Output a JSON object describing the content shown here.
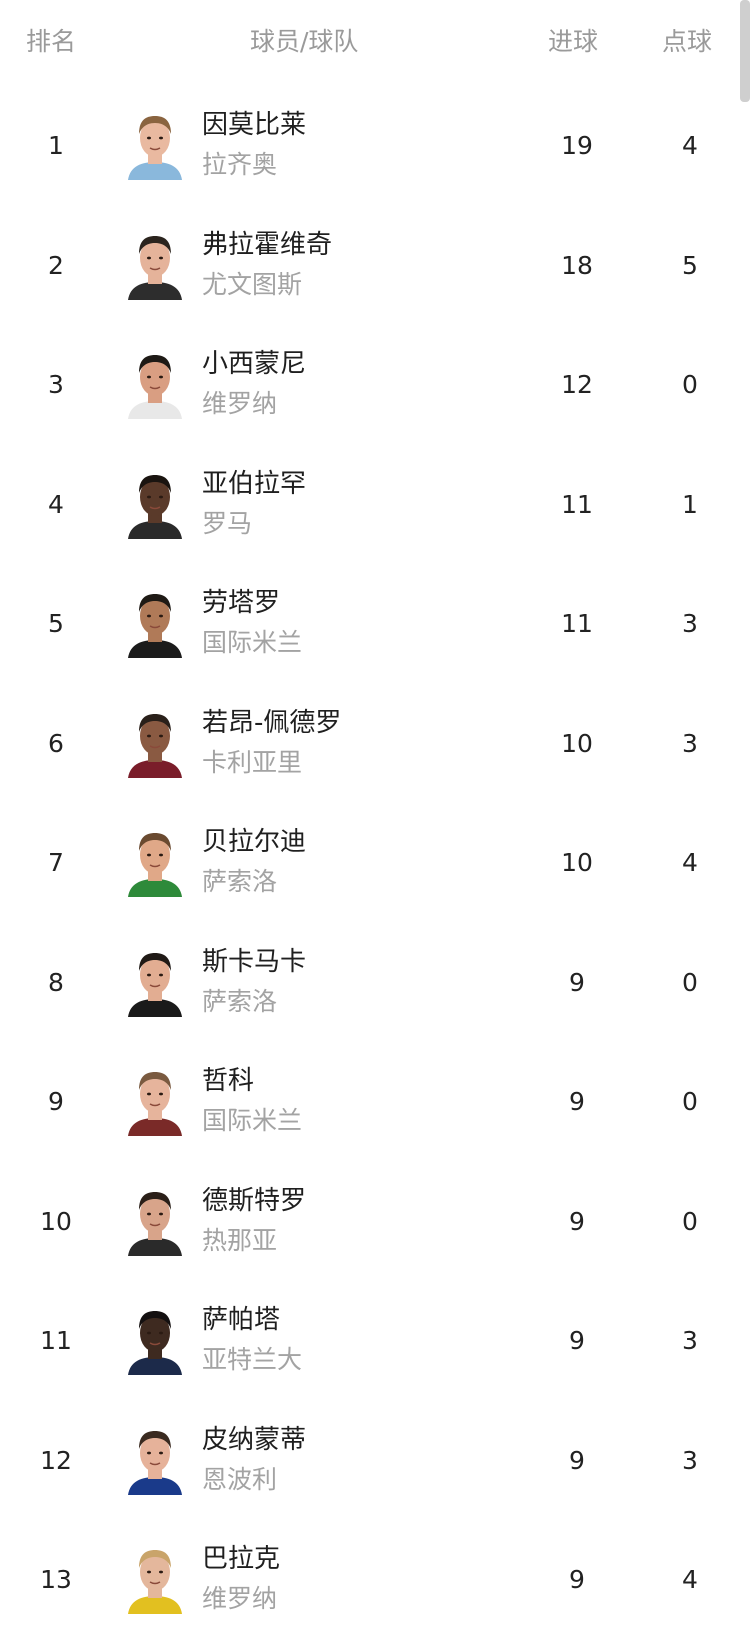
{
  "headers": {
    "rank": "排名",
    "player": "球员/球队",
    "goals": "进球",
    "penalties": "点球"
  },
  "rows": [
    {
      "rank": "1",
      "name": "因莫比莱",
      "team": "拉齐奥",
      "goals": "19",
      "penalties": "4",
      "skin": "#e9b9a0",
      "hair": "#8a6440",
      "shirt": "#8ab8dc"
    },
    {
      "rank": "2",
      "name": "弗拉霍维奇",
      "team": "尤文图斯",
      "goals": "18",
      "penalties": "5",
      "skin": "#e5b39a",
      "hair": "#2b241e",
      "shirt": "#2d2d2d"
    },
    {
      "rank": "3",
      "name": "小西蒙尼",
      "team": "维罗纳",
      "goals": "12",
      "penalties": "0",
      "skin": "#d99e82",
      "hair": "#1e1a16",
      "shirt": "#e8e8e8"
    },
    {
      "rank": "4",
      "name": "亚伯拉罕",
      "team": "罗马",
      "goals": "11",
      "penalties": "1",
      "skin": "#5a3a2a",
      "hair": "#1a1410",
      "shirt": "#2a2a2a"
    },
    {
      "rank": "5",
      "name": "劳塔罗",
      "team": "国际米兰",
      "goals": "11",
      "penalties": "3",
      "skin": "#b07a58",
      "hair": "#1f1a15",
      "shirt": "#1b1b1b"
    },
    {
      "rank": "6",
      "name": "若昂-佩德罗",
      "team": "卡利亚里",
      "goals": "10",
      "penalties": "3",
      "skin": "#8a5a42",
      "hair": "#2a201a",
      "shirt": "#7a1d2a"
    },
    {
      "rank": "7",
      "name": "贝拉尔迪",
      "team": "萨索洛",
      "goals": "10",
      "penalties": "4",
      "skin": "#e0a888",
      "hair": "#6a4a30",
      "shirt": "#2e8a3a"
    },
    {
      "rank": "8",
      "name": "斯卡马卡",
      "team": "萨索洛",
      "goals": "9",
      "penalties": "0",
      "skin": "#e2ad92",
      "hair": "#201a16",
      "shirt": "#1a1a1a"
    },
    {
      "rank": "9",
      "name": "哲科",
      "team": "国际米兰",
      "goals": "9",
      "penalties": "0",
      "skin": "#e6b49c",
      "hair": "#7a5a40",
      "shirt": "#7a2a28"
    },
    {
      "rank": "10",
      "name": "德斯特罗",
      "team": "热那亚",
      "goals": "9",
      "penalties": "0",
      "skin": "#d8a48a",
      "hair": "#2a1f18",
      "shirt": "#2a2a2a"
    },
    {
      "rank": "11",
      "name": "萨帕塔",
      "team": "亚特兰大",
      "goals": "9",
      "penalties": "3",
      "skin": "#3e2a20",
      "hair": "#141010",
      "shirt": "#1c2a4a"
    },
    {
      "rank": "12",
      "name": "皮纳蒙蒂",
      "team": "恩波利",
      "goals": "9",
      "penalties": "3",
      "skin": "#e6b29a",
      "hair": "#3a2a20",
      "shirt": "#1a3a8a"
    },
    {
      "rank": "13",
      "name": "巴拉克",
      "team": "维罗纳",
      "goals": "9",
      "penalties": "4",
      "skin": "#e4b79c",
      "hair": "#c9a46a",
      "shirt": "#e2c020"
    }
  ]
}
